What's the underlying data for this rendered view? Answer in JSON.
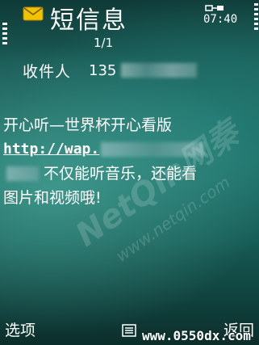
{
  "header": {
    "title": "短信息",
    "page_indicator": "1/1",
    "clock": "07:40"
  },
  "recipient": {
    "label": "收件人",
    "number_visible": "135"
  },
  "message": {
    "line1": "开心听—世界杯开心看版",
    "link_text": "http://wap.",
    "line3_text": "不仅能听音乐，还能看",
    "line4": "图片和视频哦!"
  },
  "softkeys": {
    "left": "选项",
    "right": "返回"
  },
  "overlays": {
    "watermark_text": "NetQin网秦",
    "watermark_url": "www.netqin.com",
    "site_mark": "www.0550dx.com"
  },
  "icons": {
    "message": "envelope-icon",
    "network": "network-icon",
    "menu": "menu-icon"
  },
  "colors": {
    "background": "#1f6b64",
    "text": "#ffffff",
    "envelope": "#f2c400"
  }
}
